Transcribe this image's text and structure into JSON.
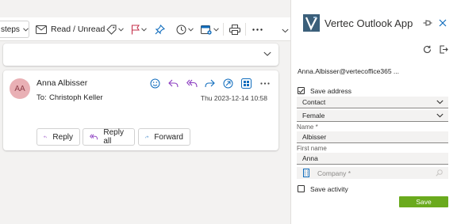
{
  "toolbar": {
    "steps_label": "steps",
    "read_unread_label": "Read / Unread"
  },
  "message": {
    "avatar_initials": "AA",
    "sender": "Anna Albisser",
    "to_label": "To:",
    "recipient": "Christoph Keller",
    "date": "Thu 2023-12-14 10:58",
    "reply_label": "Reply",
    "reply_all_label": "Reply all",
    "forward_label": "Forward"
  },
  "addin": {
    "title": "Vertec Outlook App",
    "user_email": "Anna.Albisser@vertecoffice365 ...",
    "save_address_label": "Save address",
    "save_address_checked": true,
    "type_value": "Contact",
    "gender_value": "Female",
    "name_label": "Name *",
    "name_value": "Albisser",
    "first_name_label": "First name",
    "first_name_value": "Anna",
    "company_placeholder": "Company *",
    "save_activity_label": "Save activity",
    "save_activity_checked": false,
    "save_button_label": "Save"
  },
  "colors": {
    "accent": "#0f6cbd",
    "reply_purple": "#8b3cc0",
    "flag_red": "#c4314b",
    "avatar_bg": "#e9b0b5",
    "save_green": "#6aaa1d",
    "logo_blue": "#3b5f7a"
  }
}
